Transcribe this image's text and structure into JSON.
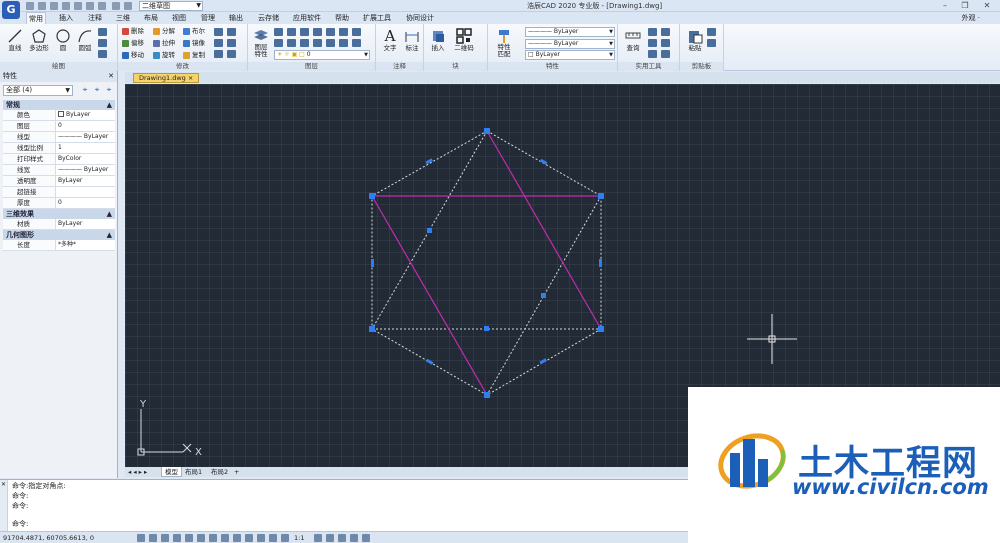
{
  "titlebar": {
    "workspace": "二维草图",
    "window_title": "浩辰CAD 2020 专业版 - [Drawing1.dwg]"
  },
  "ribbon_tabs": [
    "常用",
    "插入",
    "注释",
    "三维",
    "布局",
    "视图",
    "管理",
    "输出",
    "云存储",
    "应用软件",
    "帮助",
    "扩展工具",
    "协同设计"
  ],
  "appearance": "外观 ·",
  "ribbon": {
    "draw": {
      "label": "绘图",
      "line": "直线",
      "polygon": "多边形",
      "circle": "圆",
      "arc": "圆弧"
    },
    "modify": {
      "label": "修改",
      "delete": "删除",
      "explode": "分解",
      "boolean": "布尔",
      "offset": "偏移",
      "stretch": "拉伸",
      "mirror": "镜像",
      "move": "移动",
      "rotate": "旋转",
      "copy": "复制"
    },
    "layer": {
      "label": "图层",
      "props": "图层\n特性",
      "layer_value": "0"
    },
    "annotation": {
      "label": "注释",
      "text": "文字",
      "dim": "标注"
    },
    "block": {
      "label": "块",
      "insert": "插入",
      "qrcode": "二维码"
    },
    "properties": {
      "label": "特性",
      "match": "特性\n匹配",
      "color": "ByLayer",
      "linetype": "ByLayer",
      "lineweight": "ByLayer"
    },
    "utilities": {
      "label": "实用工具",
      "measure": "查询"
    },
    "clipboard": {
      "label": "剪贴板",
      "paste": "粘贴"
    }
  },
  "properties_panel": {
    "title": "特性",
    "selection": "全部 (4)",
    "sections": [
      {
        "name": "常规",
        "rows": [
          {
            "key": "颜色",
            "value": "ByLayer"
          },
          {
            "key": "图层",
            "value": "0"
          },
          {
            "key": "线型",
            "value": "———— ByLayer"
          },
          {
            "key": "线型比例",
            "value": "1"
          },
          {
            "key": "打印样式",
            "value": "ByColor"
          },
          {
            "key": "线宽",
            "value": "———— ByLayer"
          },
          {
            "key": "透明度",
            "value": "ByLayer"
          },
          {
            "key": "超链接",
            "value": ""
          },
          {
            "key": "厚度",
            "value": "0"
          }
        ]
      },
      {
        "name": "三维效果",
        "rows": [
          {
            "key": "材质",
            "value": "ByLayer"
          }
        ]
      },
      {
        "name": "几何图形",
        "rows": [
          {
            "key": "长度",
            "value": "*多种*"
          }
        ]
      }
    ]
  },
  "document_tab": "Drawing1.dwg",
  "layout_tabs": [
    "模型",
    "布局1",
    "布局2"
  ],
  "ucs": {
    "x": "X",
    "y": "Y"
  },
  "command_lines": [
    "命令:指定对角点:",
    "命令:",
    "命令:",
    "命令:"
  ],
  "coordinates": "91704.4871, 60705.6613, 0",
  "status_scale": "1:1",
  "watermark": {
    "name": "土木工程网",
    "url": "www.civilcn.com"
  },
  "colors": {
    "canvas": "#222a35",
    "polygon": "#d7dbe0",
    "magenta": "#c22bb0",
    "grip": "#2f7ff0",
    "brand": "#1c5fb8"
  }
}
